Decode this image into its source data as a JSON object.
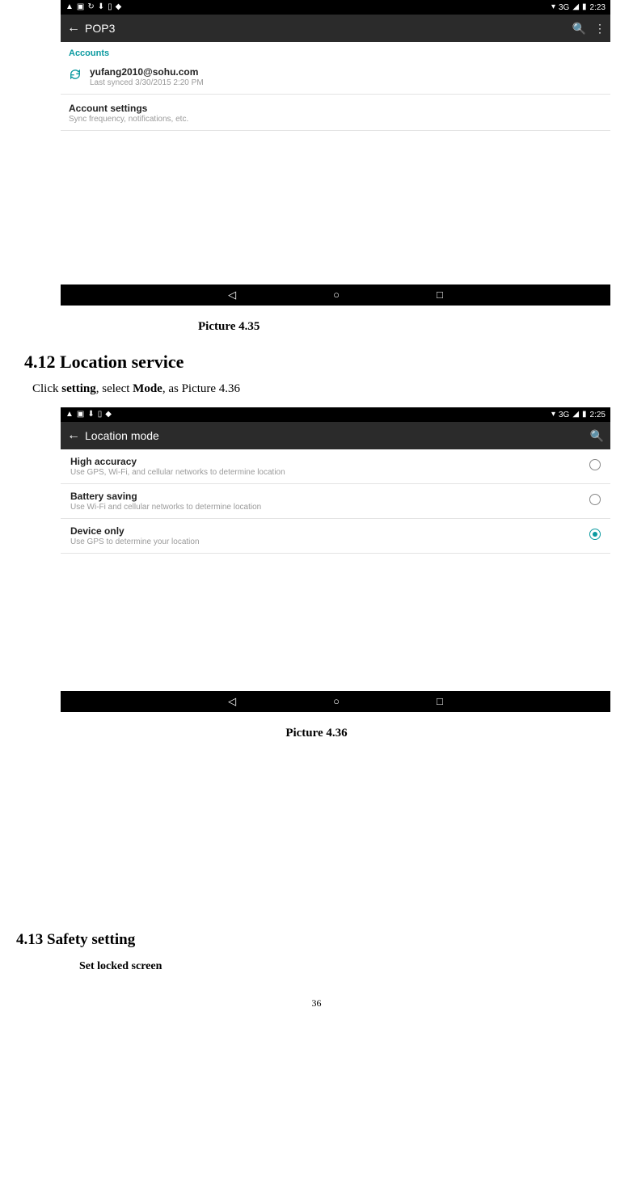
{
  "shot1": {
    "status": {
      "net": "3G",
      "batt_glyph": "▮",
      "wifi_glyph": "▾",
      "sig_glyph": "◢",
      "time": "2:23"
    },
    "appbar": {
      "title": "POP3"
    },
    "accounts_header": "Accounts",
    "account": {
      "email": "yufang2010@sohu.com",
      "synced": "Last synced 3/30/2015 2:20 PM"
    },
    "settings": {
      "title": "Account settings",
      "sub": "Sync frequency, notifications, etc."
    }
  },
  "caption1": "Picture 4.35",
  "section412": "4.12 Location service",
  "body412_pre": "Click ",
  "body412_b1": "setting",
  "body412_mid": ", select ",
  "body412_b2": "Mode",
  "body412_post": ", as Picture 4.36",
  "shot2": {
    "status": {
      "net": "3G",
      "batt_glyph": "▮",
      "wifi_glyph": "▾",
      "sig_glyph": "◢",
      "time": "2:25"
    },
    "appbar": {
      "title": "Location mode"
    },
    "rows": [
      {
        "title": "High accuracy",
        "sub": "Use GPS, Wi-Fi, and cellular networks to determine location"
      },
      {
        "title": "Battery saving",
        "sub": "Use Wi-Fi and cellular networks to determine location"
      },
      {
        "title": "Device only",
        "sub": "Use GPS to determine your location"
      }
    ]
  },
  "caption2": "Picture 4.36",
  "section413": "4.13  Safety setting",
  "sub413": "Set locked screen",
  "page_num": "36"
}
